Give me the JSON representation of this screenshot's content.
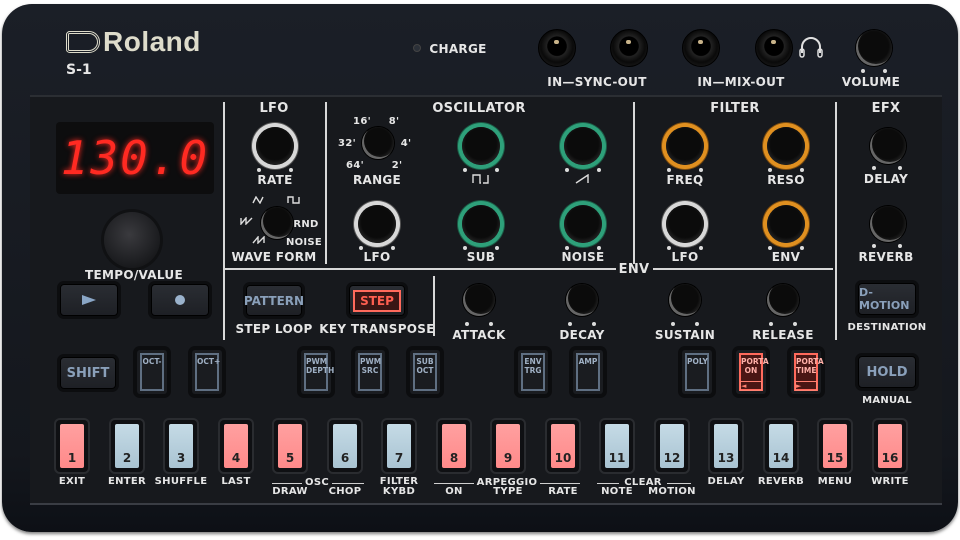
{
  "brand": {
    "logo": "Roland",
    "model": "S-1"
  },
  "top": {
    "charge_label": "CHARGE",
    "sync_label": "IN—SYNC-OUT",
    "mix_label": "IN—MIX-OUT",
    "volume_label": "VOLUME",
    "icons": {
      "headphones": "headphones-icon"
    }
  },
  "display": {
    "value": "130.0",
    "color": "#ff2a22"
  },
  "tempo": {
    "label": "TEMPO/VALUE",
    "play_icon": "play-icon",
    "record_icon": "record-icon"
  },
  "lfo": {
    "title": "LFO",
    "rate_label": "RATE",
    "waveform_label": "WAVE FORM",
    "waveforms": [
      "triangle",
      "square",
      "saw-down",
      "random",
      "saw-up",
      "noise"
    ],
    "rnd_label": "RND",
    "noise_label": "NOISE"
  },
  "oscillator": {
    "title": "OSCILLATOR",
    "range_label": "RANGE",
    "range_values": [
      "64'",
      "32'",
      "16'",
      "8'",
      "4'",
      "2'"
    ],
    "square_label": "square-wave-icon",
    "saw_label": "saw-wave-icon",
    "lfo_label": "LFO",
    "sub_label": "SUB",
    "noise_label": "NOISE",
    "ring_color": "#2ea07a"
  },
  "filter": {
    "title": "FILTER",
    "freq_label": "FREQ",
    "reso_label": "RESO",
    "lfo_label": "LFO",
    "env_label": "ENV",
    "ring_color": "#e09020"
  },
  "efx": {
    "title": "EFX",
    "delay_label": "DELAY",
    "reverb_label": "REVERB"
  },
  "env": {
    "title": "ENV",
    "attack_label": "ATTACK",
    "decay_label": "DECAY",
    "sustain_label": "SUSTAIN",
    "release_label": "RELEASE"
  },
  "mode_buttons": {
    "pattern": {
      "label": "PATTERN",
      "sub": "STEP LOOP"
    },
    "step": {
      "label": "STEP",
      "sub": "KEY TRANSPOSE",
      "active": true
    },
    "dmotion": {
      "label": "D-MOTION",
      "sub": "DESTINATION"
    },
    "hold": {
      "label": "HOLD",
      "sub": "MANUAL"
    },
    "shift": {
      "label": "SHIFT"
    }
  },
  "function_buttons": [
    {
      "label": "OCT-",
      "lit": false
    },
    {
      "label": "OCT+",
      "lit": false
    },
    {
      "label": "PWM\nDEPTH",
      "lit": false
    },
    {
      "label": "PWM\nSRC",
      "lit": false
    },
    {
      "label": "SUB\nOCT",
      "lit": false
    },
    {
      "label": "ENV\nTRG",
      "lit": false
    },
    {
      "label": "AMP",
      "lit": false
    },
    {
      "label": "POLY",
      "lit": false
    },
    {
      "label": "PORTA\nON",
      "lit": true,
      "arrow": "◄"
    },
    {
      "label": "PORTA\nTIME",
      "lit": true,
      "arrow": "►"
    }
  ],
  "steps": [
    {
      "num": "1",
      "label": "EXIT",
      "color": "red"
    },
    {
      "num": "2",
      "label": "ENTER",
      "color": "blue"
    },
    {
      "num": "3",
      "label": "SHUFFLE",
      "color": "blue"
    },
    {
      "num": "4",
      "label": "LAST",
      "color": "red"
    },
    {
      "num": "5",
      "label": "DRAW",
      "color": "red"
    },
    {
      "num": "6",
      "label": "CHOP",
      "color": "blue"
    },
    {
      "num": "7",
      "label": "FILTER\nKYBD",
      "color": "blue"
    },
    {
      "num": "8",
      "label": "ON",
      "color": "red"
    },
    {
      "num": "9",
      "label": "TYPE",
      "color": "red"
    },
    {
      "num": "10",
      "label": "RATE",
      "color": "red"
    },
    {
      "num": "11",
      "label": "NOTE",
      "color": "blue"
    },
    {
      "num": "12",
      "label": "MOTION",
      "color": "blue"
    },
    {
      "num": "13",
      "label": "DELAY",
      "color": "blue"
    },
    {
      "num": "14",
      "label": "REVERB",
      "color": "blue"
    },
    {
      "num": "15",
      "label": "MENU",
      "color": "red"
    },
    {
      "num": "16",
      "label": "WRITE",
      "color": "red"
    }
  ],
  "step_groups": {
    "osc": "OSC",
    "arpeggio": "ARPEGGIO",
    "clear": "CLEAR"
  },
  "colors": {
    "step_red": "#ff8a8a",
    "step_blue": "#b5cddb",
    "button_text": "#8aa0ba",
    "active_red": "#ff5f50"
  }
}
